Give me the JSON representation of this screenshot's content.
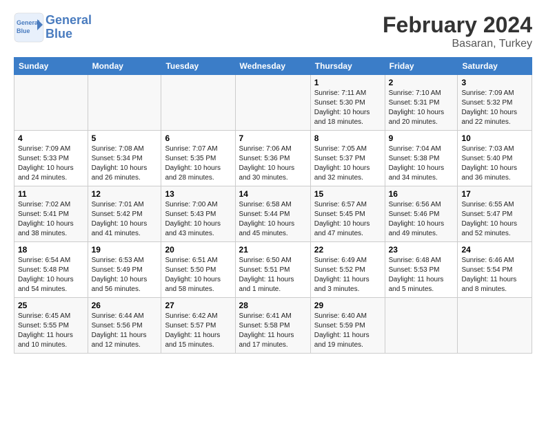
{
  "header": {
    "logo_line1": "General",
    "logo_line2": "Blue",
    "main_title": "February 2024",
    "subtitle": "Basaran, Turkey"
  },
  "columns": [
    "Sunday",
    "Monday",
    "Tuesday",
    "Wednesday",
    "Thursday",
    "Friday",
    "Saturday"
  ],
  "weeks": [
    [
      {
        "num": "",
        "info": ""
      },
      {
        "num": "",
        "info": ""
      },
      {
        "num": "",
        "info": ""
      },
      {
        "num": "",
        "info": ""
      },
      {
        "num": "1",
        "info": "Sunrise: 7:11 AM\nSunset: 5:30 PM\nDaylight: 10 hours\nand 18 minutes."
      },
      {
        "num": "2",
        "info": "Sunrise: 7:10 AM\nSunset: 5:31 PM\nDaylight: 10 hours\nand 20 minutes."
      },
      {
        "num": "3",
        "info": "Sunrise: 7:09 AM\nSunset: 5:32 PM\nDaylight: 10 hours\nand 22 minutes."
      }
    ],
    [
      {
        "num": "4",
        "info": "Sunrise: 7:09 AM\nSunset: 5:33 PM\nDaylight: 10 hours\nand 24 minutes."
      },
      {
        "num": "5",
        "info": "Sunrise: 7:08 AM\nSunset: 5:34 PM\nDaylight: 10 hours\nand 26 minutes."
      },
      {
        "num": "6",
        "info": "Sunrise: 7:07 AM\nSunset: 5:35 PM\nDaylight: 10 hours\nand 28 minutes."
      },
      {
        "num": "7",
        "info": "Sunrise: 7:06 AM\nSunset: 5:36 PM\nDaylight: 10 hours\nand 30 minutes."
      },
      {
        "num": "8",
        "info": "Sunrise: 7:05 AM\nSunset: 5:37 PM\nDaylight: 10 hours\nand 32 minutes."
      },
      {
        "num": "9",
        "info": "Sunrise: 7:04 AM\nSunset: 5:38 PM\nDaylight: 10 hours\nand 34 minutes."
      },
      {
        "num": "10",
        "info": "Sunrise: 7:03 AM\nSunset: 5:40 PM\nDaylight: 10 hours\nand 36 minutes."
      }
    ],
    [
      {
        "num": "11",
        "info": "Sunrise: 7:02 AM\nSunset: 5:41 PM\nDaylight: 10 hours\nand 38 minutes."
      },
      {
        "num": "12",
        "info": "Sunrise: 7:01 AM\nSunset: 5:42 PM\nDaylight: 10 hours\nand 41 minutes."
      },
      {
        "num": "13",
        "info": "Sunrise: 7:00 AM\nSunset: 5:43 PM\nDaylight: 10 hours\nand 43 minutes."
      },
      {
        "num": "14",
        "info": "Sunrise: 6:58 AM\nSunset: 5:44 PM\nDaylight: 10 hours\nand 45 minutes."
      },
      {
        "num": "15",
        "info": "Sunrise: 6:57 AM\nSunset: 5:45 PM\nDaylight: 10 hours\nand 47 minutes."
      },
      {
        "num": "16",
        "info": "Sunrise: 6:56 AM\nSunset: 5:46 PM\nDaylight: 10 hours\nand 49 minutes."
      },
      {
        "num": "17",
        "info": "Sunrise: 6:55 AM\nSunset: 5:47 PM\nDaylight: 10 hours\nand 52 minutes."
      }
    ],
    [
      {
        "num": "18",
        "info": "Sunrise: 6:54 AM\nSunset: 5:48 PM\nDaylight: 10 hours\nand 54 minutes."
      },
      {
        "num": "19",
        "info": "Sunrise: 6:53 AM\nSunset: 5:49 PM\nDaylight: 10 hours\nand 56 minutes."
      },
      {
        "num": "20",
        "info": "Sunrise: 6:51 AM\nSunset: 5:50 PM\nDaylight: 10 hours\nand 58 minutes."
      },
      {
        "num": "21",
        "info": "Sunrise: 6:50 AM\nSunset: 5:51 PM\nDaylight: 11 hours\nand 1 minute."
      },
      {
        "num": "22",
        "info": "Sunrise: 6:49 AM\nSunset: 5:52 PM\nDaylight: 11 hours\nand 3 minutes."
      },
      {
        "num": "23",
        "info": "Sunrise: 6:48 AM\nSunset: 5:53 PM\nDaylight: 11 hours\nand 5 minutes."
      },
      {
        "num": "24",
        "info": "Sunrise: 6:46 AM\nSunset: 5:54 PM\nDaylight: 11 hours\nand 8 minutes."
      }
    ],
    [
      {
        "num": "25",
        "info": "Sunrise: 6:45 AM\nSunset: 5:55 PM\nDaylight: 11 hours\nand 10 minutes."
      },
      {
        "num": "26",
        "info": "Sunrise: 6:44 AM\nSunset: 5:56 PM\nDaylight: 11 hours\nand 12 minutes."
      },
      {
        "num": "27",
        "info": "Sunrise: 6:42 AM\nSunset: 5:57 PM\nDaylight: 11 hours\nand 15 minutes."
      },
      {
        "num": "28",
        "info": "Sunrise: 6:41 AM\nSunset: 5:58 PM\nDaylight: 11 hours\nand 17 minutes."
      },
      {
        "num": "29",
        "info": "Sunrise: 6:40 AM\nSunset: 5:59 PM\nDaylight: 11 hours\nand 19 minutes."
      },
      {
        "num": "",
        "info": ""
      },
      {
        "num": "",
        "info": ""
      }
    ]
  ]
}
